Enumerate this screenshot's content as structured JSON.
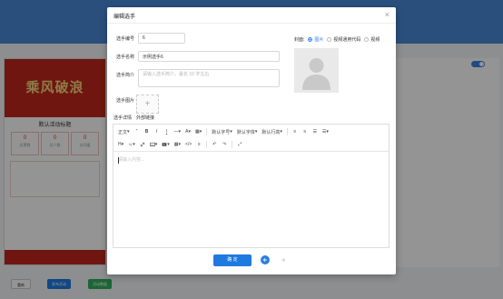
{
  "modal": {
    "title": "编辑选手",
    "close_glyph": "×",
    "form": {
      "number_label": "选手编号",
      "number_value": "6",
      "name_label": "选手名称",
      "name_value": "示例选手6",
      "intro_label": "选手简介",
      "intro_placeholder": "请输入选手简介，最长 10 字左右",
      "photo_label": "选手图片",
      "detail_label": "选手详情",
      "external_link_label": "外部链接",
      "cover_label": "封面:",
      "cover_options": [
        "图片",
        "视频通用代码",
        "视频"
      ],
      "cover_selected": "图片"
    },
    "editor": {
      "toolbar_row1": [
        "正文",
        "\"",
        "B",
        "I",
        "I",
        "—",
        "A",
        "▦",
        "默认字号",
        "默认字体",
        "默认行高",
        "≡",
        "≡",
        "☰",
        "☰"
      ],
      "toolbar_row2": [
        "H",
        "☺",
        "🔗",
        "▣",
        "▶",
        "▦",
        "</>",
        "≡",
        "↶",
        "↷",
        "⤢"
      ],
      "placeholder": "请输入内容..."
    },
    "confirm_label": "确 定"
  },
  "background": {
    "phone_banner": "乘风破浪",
    "phone_title": "默认活动标题",
    "stats": [
      {
        "value": "0",
        "label": "总票数"
      },
      {
        "value": "0",
        "label": "总人数"
      },
      {
        "value": "0",
        "label": "访问量"
      }
    ],
    "buttons": [
      "重新",
      "发布活动",
      "活动数据"
    ],
    "colors": {
      "accent": "#1f7ae0",
      "banner": "#c0261d",
      "header": "#4a88d8"
    }
  }
}
